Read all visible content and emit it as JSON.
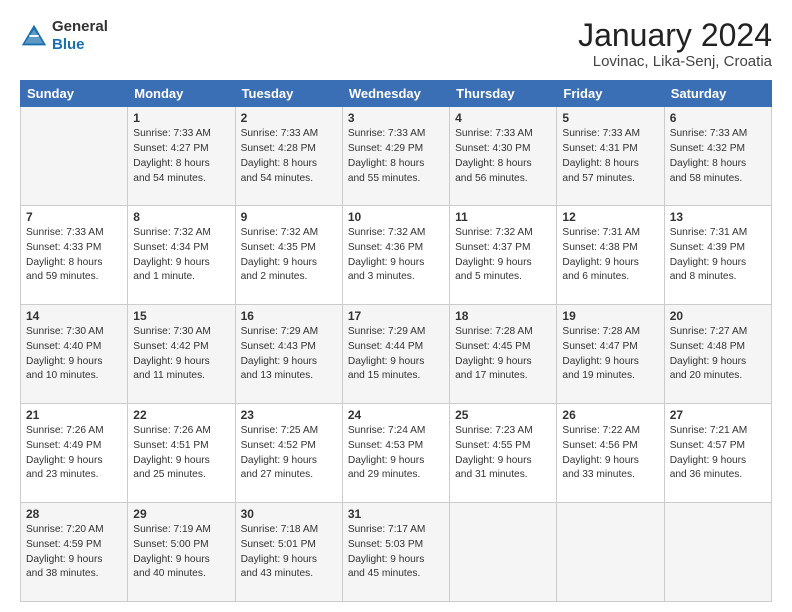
{
  "header": {
    "logo_general": "General",
    "logo_blue": "Blue",
    "title": "January 2024",
    "subtitle": "Lovinac, Lika-Senj, Croatia"
  },
  "days_of_week": [
    "Sunday",
    "Monday",
    "Tuesday",
    "Wednesday",
    "Thursday",
    "Friday",
    "Saturday"
  ],
  "weeks": [
    [
      {
        "day": "",
        "info": ""
      },
      {
        "day": "1",
        "info": "Sunrise: 7:33 AM\nSunset: 4:27 PM\nDaylight: 8 hours\nand 54 minutes."
      },
      {
        "day": "2",
        "info": "Sunrise: 7:33 AM\nSunset: 4:28 PM\nDaylight: 8 hours\nand 54 minutes."
      },
      {
        "day": "3",
        "info": "Sunrise: 7:33 AM\nSunset: 4:29 PM\nDaylight: 8 hours\nand 55 minutes."
      },
      {
        "day": "4",
        "info": "Sunrise: 7:33 AM\nSunset: 4:30 PM\nDaylight: 8 hours\nand 56 minutes."
      },
      {
        "day": "5",
        "info": "Sunrise: 7:33 AM\nSunset: 4:31 PM\nDaylight: 8 hours\nand 57 minutes."
      },
      {
        "day": "6",
        "info": "Sunrise: 7:33 AM\nSunset: 4:32 PM\nDaylight: 8 hours\nand 58 minutes."
      }
    ],
    [
      {
        "day": "7",
        "info": "Sunrise: 7:33 AM\nSunset: 4:33 PM\nDaylight: 8 hours\nand 59 minutes."
      },
      {
        "day": "8",
        "info": "Sunrise: 7:32 AM\nSunset: 4:34 PM\nDaylight: 9 hours\nand 1 minute."
      },
      {
        "day": "9",
        "info": "Sunrise: 7:32 AM\nSunset: 4:35 PM\nDaylight: 9 hours\nand 2 minutes."
      },
      {
        "day": "10",
        "info": "Sunrise: 7:32 AM\nSunset: 4:36 PM\nDaylight: 9 hours\nand 3 minutes."
      },
      {
        "day": "11",
        "info": "Sunrise: 7:32 AM\nSunset: 4:37 PM\nDaylight: 9 hours\nand 5 minutes."
      },
      {
        "day": "12",
        "info": "Sunrise: 7:31 AM\nSunset: 4:38 PM\nDaylight: 9 hours\nand 6 minutes."
      },
      {
        "day": "13",
        "info": "Sunrise: 7:31 AM\nSunset: 4:39 PM\nDaylight: 9 hours\nand 8 minutes."
      }
    ],
    [
      {
        "day": "14",
        "info": "Sunrise: 7:30 AM\nSunset: 4:40 PM\nDaylight: 9 hours\nand 10 minutes."
      },
      {
        "day": "15",
        "info": "Sunrise: 7:30 AM\nSunset: 4:42 PM\nDaylight: 9 hours\nand 11 minutes."
      },
      {
        "day": "16",
        "info": "Sunrise: 7:29 AM\nSunset: 4:43 PM\nDaylight: 9 hours\nand 13 minutes."
      },
      {
        "day": "17",
        "info": "Sunrise: 7:29 AM\nSunset: 4:44 PM\nDaylight: 9 hours\nand 15 minutes."
      },
      {
        "day": "18",
        "info": "Sunrise: 7:28 AM\nSunset: 4:45 PM\nDaylight: 9 hours\nand 17 minutes."
      },
      {
        "day": "19",
        "info": "Sunrise: 7:28 AM\nSunset: 4:47 PM\nDaylight: 9 hours\nand 19 minutes."
      },
      {
        "day": "20",
        "info": "Sunrise: 7:27 AM\nSunset: 4:48 PM\nDaylight: 9 hours\nand 20 minutes."
      }
    ],
    [
      {
        "day": "21",
        "info": "Sunrise: 7:26 AM\nSunset: 4:49 PM\nDaylight: 9 hours\nand 23 minutes."
      },
      {
        "day": "22",
        "info": "Sunrise: 7:26 AM\nSunset: 4:51 PM\nDaylight: 9 hours\nand 25 minutes."
      },
      {
        "day": "23",
        "info": "Sunrise: 7:25 AM\nSunset: 4:52 PM\nDaylight: 9 hours\nand 27 minutes."
      },
      {
        "day": "24",
        "info": "Sunrise: 7:24 AM\nSunset: 4:53 PM\nDaylight: 9 hours\nand 29 minutes."
      },
      {
        "day": "25",
        "info": "Sunrise: 7:23 AM\nSunset: 4:55 PM\nDaylight: 9 hours\nand 31 minutes."
      },
      {
        "day": "26",
        "info": "Sunrise: 7:22 AM\nSunset: 4:56 PM\nDaylight: 9 hours\nand 33 minutes."
      },
      {
        "day": "27",
        "info": "Sunrise: 7:21 AM\nSunset: 4:57 PM\nDaylight: 9 hours\nand 36 minutes."
      }
    ],
    [
      {
        "day": "28",
        "info": "Sunrise: 7:20 AM\nSunset: 4:59 PM\nDaylight: 9 hours\nand 38 minutes."
      },
      {
        "day": "29",
        "info": "Sunrise: 7:19 AM\nSunset: 5:00 PM\nDaylight: 9 hours\nand 40 minutes."
      },
      {
        "day": "30",
        "info": "Sunrise: 7:18 AM\nSunset: 5:01 PM\nDaylight: 9 hours\nand 43 minutes."
      },
      {
        "day": "31",
        "info": "Sunrise: 7:17 AM\nSunset: 5:03 PM\nDaylight: 9 hours\nand 45 minutes."
      },
      {
        "day": "",
        "info": ""
      },
      {
        "day": "",
        "info": ""
      },
      {
        "day": "",
        "info": ""
      }
    ]
  ]
}
